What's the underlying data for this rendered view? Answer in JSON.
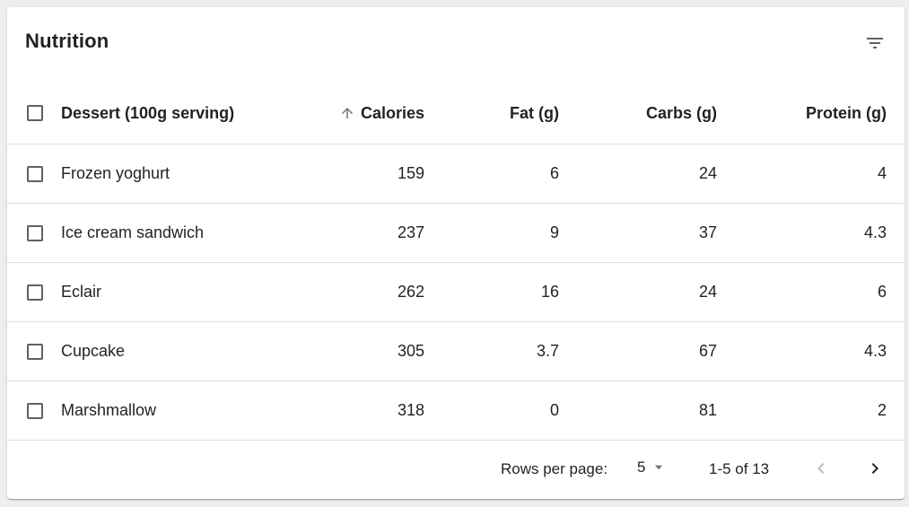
{
  "toolbar": {
    "title": "Nutrition",
    "filter_icon": "filter-list-icon"
  },
  "table": {
    "headers": {
      "dessert": "Dessert (100g serving)",
      "calories": "Calories",
      "fat": "Fat (g)",
      "carbs": "Carbs (g)",
      "protein": "Protein (g)"
    },
    "sort": {
      "column": "calories",
      "direction": "ascending",
      "icon": "arrow-upward-icon"
    },
    "rows": [
      {
        "name": "Frozen yoghurt",
        "calories": "159",
        "fat": "6",
        "carbs": "24",
        "protein": "4"
      },
      {
        "name": "Ice cream sandwich",
        "calories": "237",
        "fat": "9",
        "carbs": "37",
        "protein": "4.3"
      },
      {
        "name": "Eclair",
        "calories": "262",
        "fat": "16",
        "carbs": "24",
        "protein": "6"
      },
      {
        "name": "Cupcake",
        "calories": "305",
        "fat": "3.7",
        "carbs": "67",
        "protein": "4.3"
      },
      {
        "name": "Marshmallow",
        "calories": "318",
        "fat": "0",
        "carbs": "81",
        "protein": "2"
      }
    ]
  },
  "pagination": {
    "rows_per_page_label": "Rows per page:",
    "rows_per_page_value": "5",
    "range_text": "1-5 of 13",
    "prev_icon": "chevron-left-icon",
    "next_icon": "chevron-right-icon"
  }
}
